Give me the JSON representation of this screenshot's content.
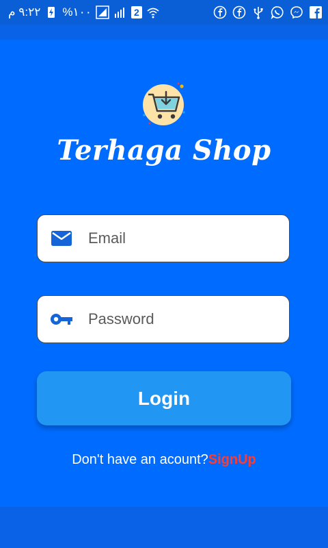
{
  "status_bar": {
    "time": "٩:٢٢ م",
    "battery": "%١٠٠",
    "sim_badge": "2",
    "left_icons": [
      "charging-battery-icon",
      "signal-icon",
      "signal-icon",
      "sim-2-icon",
      "wifi-icon"
    ],
    "right_icons": [
      "facebook-icon",
      "facebook-icon",
      "usb-icon",
      "whatsapp-icon",
      "messenger-icon",
      "facebook-icon"
    ]
  },
  "app": {
    "title": "Terhaga Shop",
    "logo_icon": "shopping-cart-icon"
  },
  "form": {
    "email_placeholder": "Email",
    "password_placeholder": "Password",
    "login_label": "Login"
  },
  "footer": {
    "prompt": "Don't have an acount?",
    "signup_label": "SignUp"
  },
  "colors": {
    "background": "#006cff",
    "button": "#2196f3",
    "signup": "#ff3b30"
  }
}
